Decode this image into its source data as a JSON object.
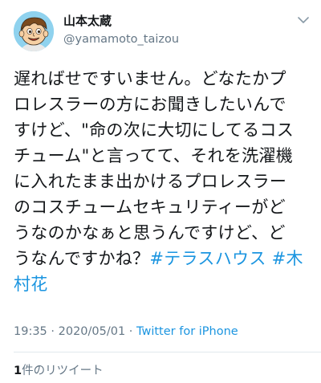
{
  "author": {
    "display_name": "山本太蔵",
    "handle": "@yamamoto_taizou",
    "avatar_icon": "cartoon-face-avatar"
  },
  "tweet": {
    "lines": [
      "遅ればせですいません。どなたかプ",
      "ロレスラーの方にお聞きしたいんで",
      "すけど、\"命の次に大切にしてるコス",
      "チューム\"と言ってて、それを洗濯機",
      "に入れたまま出かけるプロレスラー",
      "のコスチュームセキュリティーがど",
      "うなのかなぁと思うんですけど、ど",
      "うなんですかね？"
    ],
    "hashtag_1": "#テラスハウス",
    "hashtag_2_part1": "#木",
    "hashtag_2_part2": "村花"
  },
  "meta": {
    "timestamp": "19:35 · 2020/05/01 · ",
    "source": "Twitter for iPhone"
  },
  "stats": {
    "retweet_count": "1",
    "retweet_label": "件のリツイート"
  },
  "colors": {
    "link": "#1b95e0",
    "text": "#14171a",
    "secondary": "#657786",
    "divider": "#e1e8ed"
  }
}
